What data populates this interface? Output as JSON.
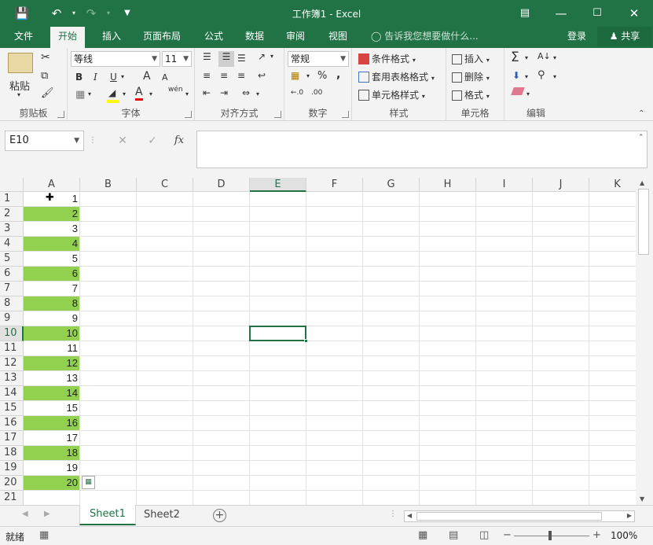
{
  "title": "工作簿1 - Excel",
  "menu": {
    "tabs": [
      "文件",
      "开始",
      "插入",
      "页面布局",
      "公式",
      "数据",
      "审阅",
      "视图"
    ],
    "active_tab": "开始",
    "tell_me": "告诉我您想要做什么...",
    "login": "登录",
    "share": "共享"
  },
  "ribbon": {
    "clipboard": {
      "paste": "粘贴",
      "label": "剪贴板"
    },
    "font": {
      "name": "等线",
      "size": "11",
      "label": "字体",
      "bold": "B",
      "italic": "I",
      "underline": "U",
      "grow": "A",
      "shrink": "A",
      "wen": "wén"
    },
    "align": {
      "label": "对齐方式"
    },
    "number": {
      "format": "常规",
      "label": "数字",
      "percent": "%",
      "comma": ",",
      "inc": "←.0",
      "dec": ".00"
    },
    "styles": {
      "conditional": "条件格式",
      "table": "套用表格格式",
      "cell": "单元格样式",
      "label": "样式"
    },
    "cells": {
      "insert": "插入",
      "delete": "删除",
      "format": "格式",
      "label": "单元格"
    },
    "editing": {
      "label": "编辑"
    }
  },
  "formula_bar": {
    "name_box": "E10",
    "fx": "fx",
    "value": ""
  },
  "grid": {
    "columns": [
      "A",
      "B",
      "C",
      "D",
      "E",
      "F",
      "G",
      "H",
      "I",
      "J",
      "K"
    ],
    "selected_column": "E",
    "selected_row": 10,
    "rows": [
      1,
      2,
      3,
      4,
      5,
      6,
      7,
      8,
      9,
      10,
      11,
      12,
      13,
      14,
      15,
      16,
      17,
      18,
      19,
      20,
      21
    ],
    "col_a_values": [
      "1",
      "2",
      "3",
      "4",
      "5",
      "6",
      "7",
      "8",
      "9",
      "10",
      "11",
      "12",
      "13",
      "14",
      "15",
      "16",
      "17",
      "18",
      "19",
      "20",
      ""
    ],
    "highlight_color": "#92d050",
    "highlight_rows": [
      2,
      4,
      6,
      8,
      10,
      12,
      14,
      16,
      18,
      20
    ]
  },
  "sheets": {
    "tabs": [
      "Sheet1",
      "Sheet2"
    ],
    "active": "Sheet1"
  },
  "status": {
    "ready": "就绪",
    "zoom": "100%",
    "minus": "−",
    "plus": "+"
  },
  "accent_color": "#217346"
}
